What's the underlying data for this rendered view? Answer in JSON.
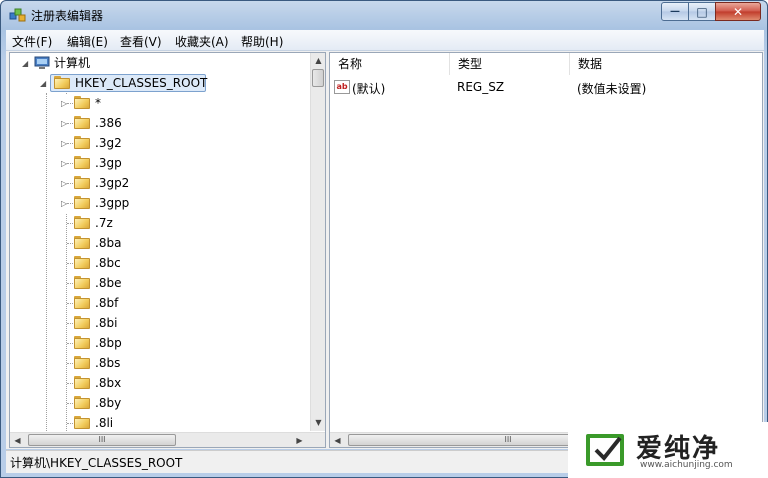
{
  "window": {
    "title": "注册表编辑器",
    "controls": {
      "minimize": "—",
      "maximize": "□",
      "close": "✕"
    }
  },
  "menu": [
    "文件(F)",
    "编辑(E)",
    "查看(V)",
    "收藏夹(A)",
    "帮助(H)"
  ],
  "tree": {
    "root_label": "计算机",
    "expanded_key": "HKEY_CLASSES_ROOT",
    "children": [
      {
        "label": "*",
        "expandable": true
      },
      {
        "label": ".386",
        "expandable": true
      },
      {
        "label": ".3g2",
        "expandable": true
      },
      {
        "label": ".3gp",
        "expandable": true
      },
      {
        "label": ".3gp2",
        "expandable": true
      },
      {
        "label": ".3gpp",
        "expandable": true
      },
      {
        "label": ".7z",
        "expandable": false
      },
      {
        "label": ".8ba",
        "expandable": false
      },
      {
        "label": ".8bc",
        "expandable": false
      },
      {
        "label": ".8be",
        "expandable": false
      },
      {
        "label": ".8bf",
        "expandable": false
      },
      {
        "label": ".8bi",
        "expandable": false
      },
      {
        "label": ".8bp",
        "expandable": false
      },
      {
        "label": ".8bs",
        "expandable": false
      },
      {
        "label": ".8bx",
        "expandable": false
      },
      {
        "label": ".8by",
        "expandable": false
      },
      {
        "label": ".8li",
        "expandable": false
      }
    ]
  },
  "list": {
    "columns": [
      "名称",
      "类型",
      "数据"
    ],
    "rows": [
      {
        "icon": "ab",
        "name": "(默认)",
        "type": "REG_SZ",
        "data": "(数值未设置)"
      }
    ]
  },
  "scroll": {
    "thumb_grip": "III"
  },
  "status": "计算机\\HKEY_CLASSES_ROOT",
  "watermark": {
    "name": "爱纯净",
    "url": "www.aichunjing.com",
    "accent": "#3a9a2a"
  }
}
